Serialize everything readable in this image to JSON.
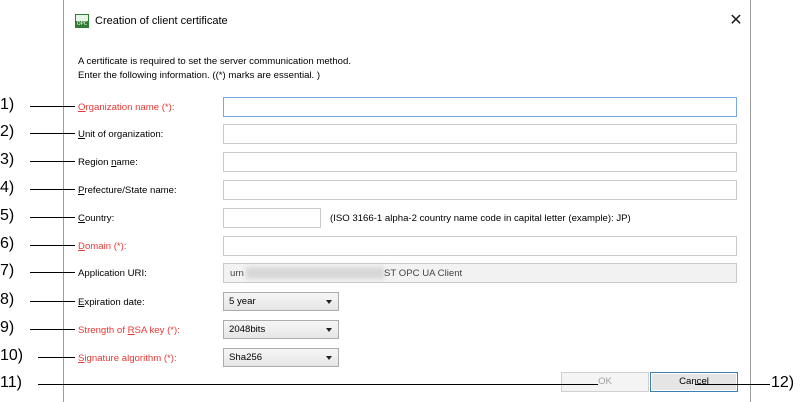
{
  "dialog": {
    "title": "Creation of client certificate",
    "close_glyph": "✕",
    "icon_text": "OPC",
    "intro_line1": "A certificate is required to set the server communication method.",
    "intro_line2": "Enter the following information. ((*) marks are essential. )"
  },
  "fields": {
    "organization_name": {
      "prefix": "",
      "accel": "O",
      "rest": "rganization name (*):",
      "value": ""
    },
    "unit_of_organization": {
      "prefix": "",
      "accel": "U",
      "rest": "nit of organization:",
      "value": ""
    },
    "region_name": {
      "prefix": "Region ",
      "accel": "n",
      "rest": "ame:",
      "value": ""
    },
    "prefecture_state_name": {
      "prefix": "",
      "accel": "P",
      "rest": "refecture/State name:",
      "value": ""
    },
    "country": {
      "prefix": "",
      "accel": "C",
      "rest": "ountry:",
      "value": "",
      "hint": "(ISO 3166-1 alpha-2 country name code in capital letter (example): JP)"
    },
    "domain": {
      "prefix": "",
      "accel": "D",
      "rest": "omain (*):",
      "value": ""
    },
    "application_uri": {
      "label": "Application URI:",
      "value_start": "urn",
      "value_end": "ST OPC UA Client"
    },
    "expiration_date": {
      "prefix": "",
      "accel": "E",
      "rest": "xpiration date:",
      "value": "5 year"
    },
    "rsa_key_strength": {
      "prefix": "Strength of ",
      "accel": "R",
      "rest": "SA key (*):",
      "value": "2048bits"
    },
    "signature_algorithm": {
      "prefix": "",
      "accel": "S",
      "rest": "ignature algorithm (*):",
      "value": "Sha256"
    }
  },
  "buttons": {
    "ok": "OK",
    "cancel": "Cancel"
  },
  "callouts": [
    "1)",
    "2)",
    "3)",
    "4)",
    "5)",
    "6)",
    "7)",
    "8)",
    "9)",
    "10)",
    "11)",
    "12)"
  ],
  "colors": {
    "required_label": "#e53935",
    "focus_border": "#7aa7e0"
  }
}
